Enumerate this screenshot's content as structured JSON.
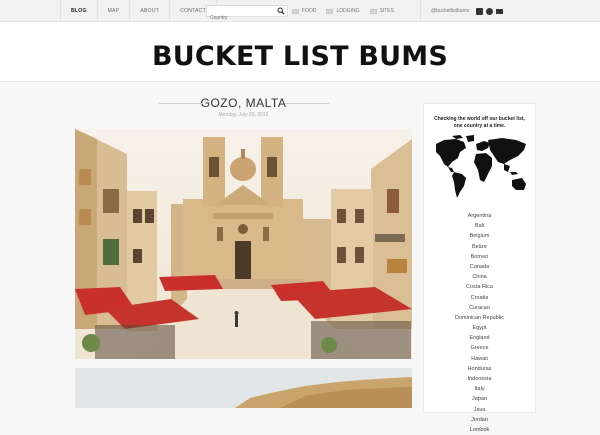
{
  "nav": {
    "items": [
      {
        "label": "BLOG",
        "active": true
      },
      {
        "label": "MAP",
        "active": false
      },
      {
        "label": "ABOUT",
        "active": false
      },
      {
        "label": "CONTACT",
        "active": false
      }
    ]
  },
  "search": {
    "placeholder": "Country"
  },
  "categories": [
    {
      "label": "FOOD"
    },
    {
      "label": "LODGING"
    },
    {
      "label": "SITES"
    }
  ],
  "social": {
    "handle": "@bucketlistbums",
    "icons": [
      "instagram-icon",
      "twitter-icon",
      "email-icon"
    ]
  },
  "site": {
    "title": "BUCKET LIST BUMS"
  },
  "post": {
    "title": "GOZO, MALTA",
    "date": "Monday, July 20, 2015"
  },
  "sidebar": {
    "tagline_line1": "Checking the world off our bucket list,",
    "tagline_line2": "one country at a time.",
    "countries": [
      "Argentina",
      "Bali",
      "Belgium",
      "Belize",
      "Borneo",
      "Canada",
      "China",
      "Costa Rica",
      "Croatia",
      "Curacao",
      "Dominican Republic",
      "Egypt",
      "England",
      "Greece",
      "Hawaii",
      "Honduras",
      "Indonesia",
      "Italy",
      "Japan",
      "Java",
      "Jordan",
      "Lombok"
    ]
  },
  "colors": {
    "accent": "#111111",
    "awning": "#c9302c",
    "stone": "#d9b98a"
  }
}
